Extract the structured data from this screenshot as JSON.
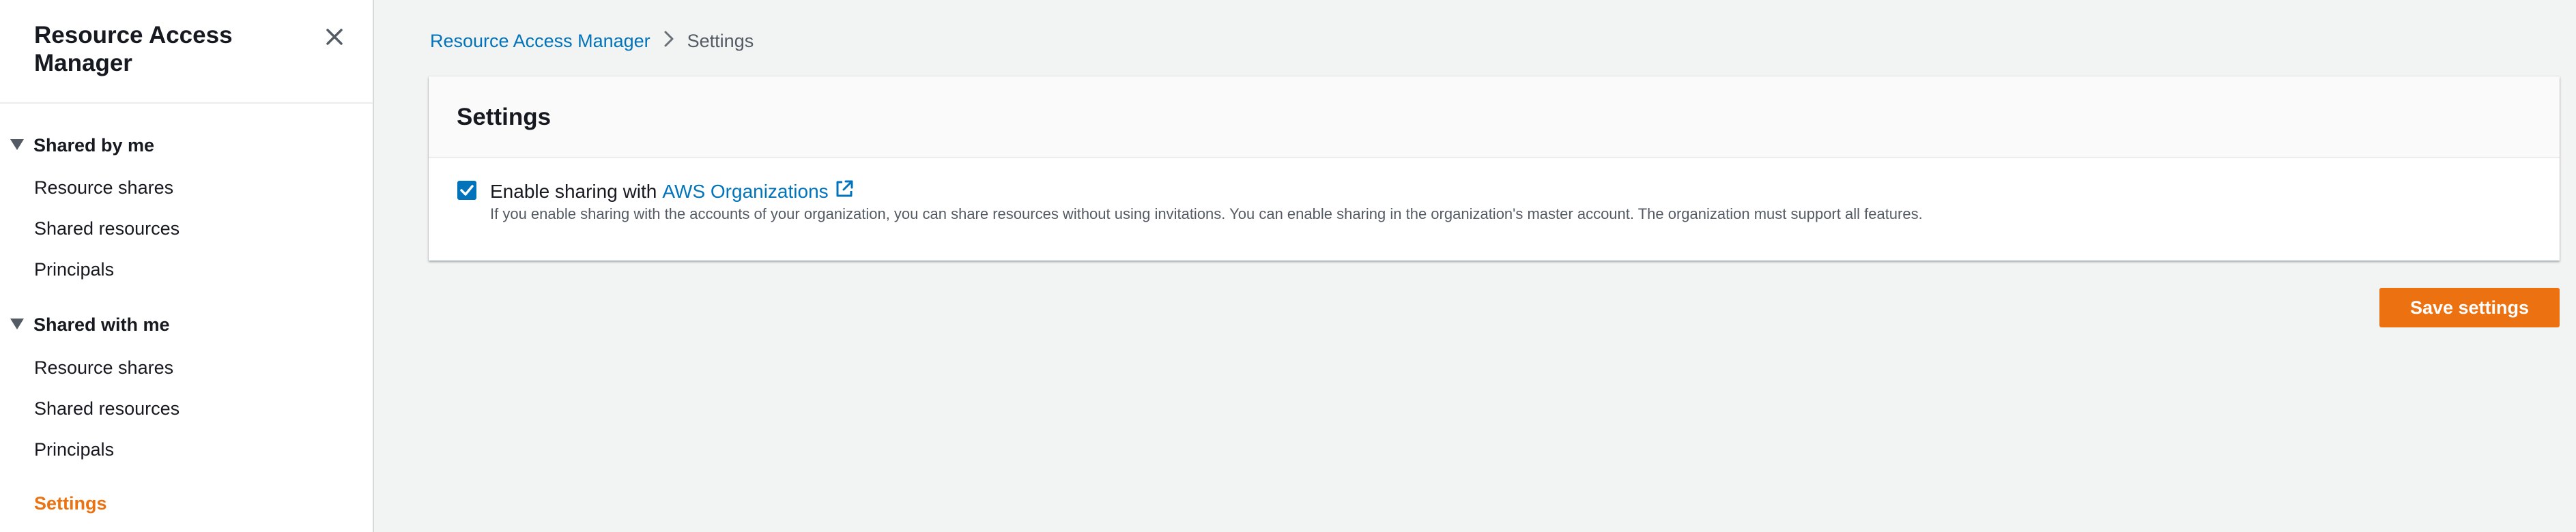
{
  "sidebar": {
    "title": "Resource Access Manager",
    "close_icon": "close-icon",
    "sections": [
      {
        "label": "Shared by me",
        "items": [
          {
            "label": "Resource shares"
          },
          {
            "label": "Shared resources"
          },
          {
            "label": "Principals"
          }
        ]
      },
      {
        "label": "Shared with me",
        "items": [
          {
            "label": "Resource shares"
          },
          {
            "label": "Shared resources"
          },
          {
            "label": "Principals"
          }
        ]
      }
    ],
    "settings_label": "Settings",
    "active_color": "#ec7211"
  },
  "breadcrumb": {
    "root": "Resource Access Manager",
    "current": "Settings"
  },
  "settings_panel": {
    "title": "Settings",
    "checkbox_checked": true,
    "option_label": "Enable sharing with",
    "option_link": "AWS Organizations",
    "option_link_icon": "external-link-icon",
    "option_description": "If you enable sharing with the accounts of your organization, you can share resources without using invitations. You can enable sharing in the organization's master account. The organization must support all features."
  },
  "actions": {
    "save_label": "Save settings",
    "save_color": "#ec7211"
  },
  "colors": {
    "link": "#0073bb",
    "background": "#f2f3f3"
  }
}
